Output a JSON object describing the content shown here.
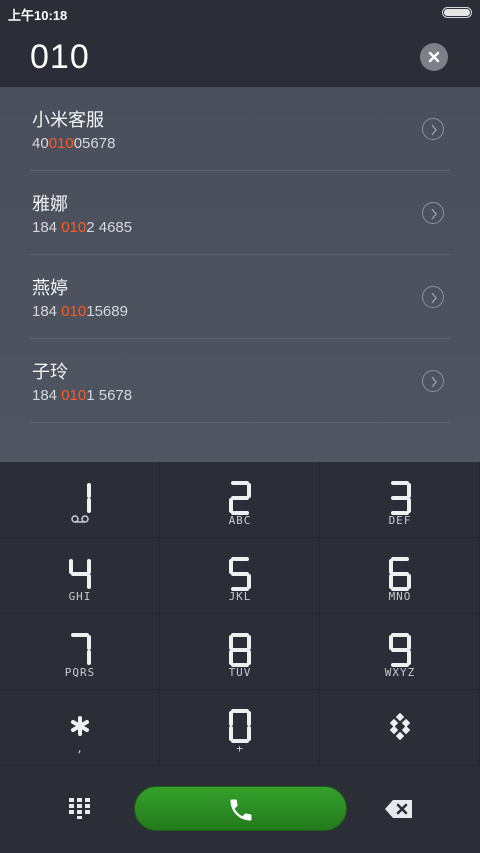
{
  "status_bar": {
    "time": "上午10:18"
  },
  "dial_input": {
    "number": "010"
  },
  "contacts": [
    {
      "name": "小米客服",
      "number_pre": "40",
      "number_match": "010",
      "number_post": "05678"
    },
    {
      "name": "雅娜",
      "number_pre": "184 ",
      "number_match": "010",
      "number_post": "2 4685"
    },
    {
      "name": "燕婷",
      "number_pre": "184 ",
      "number_match": "010",
      "number_post": "15689"
    },
    {
      "name": "子玲",
      "number_pre": "184 ",
      "number_match": "010",
      "number_post": "1 5678"
    }
  ],
  "keypad": {
    "keys": [
      {
        "digit": "1",
        "letters": ""
      },
      {
        "digit": "2",
        "letters": "ABC"
      },
      {
        "digit": "3",
        "letters": "DEF"
      },
      {
        "digit": "4",
        "letters": "GHI"
      },
      {
        "digit": "5",
        "letters": "JKL"
      },
      {
        "digit": "6",
        "letters": "MNO"
      },
      {
        "digit": "7",
        "letters": "PQRS"
      },
      {
        "digit": "8",
        "letters": "TUV"
      },
      {
        "digit": "9",
        "letters": "WXYZ"
      },
      {
        "digit": "*",
        "letters": ","
      },
      {
        "digit": "0",
        "letters": "+"
      },
      {
        "digit": "#",
        "letters": ""
      }
    ]
  },
  "colors": {
    "match_highlight": "#ff5a1f",
    "call_button": "#2e8f25",
    "background": "#2b2e36"
  },
  "icons": {
    "clear": "clear-icon",
    "chevron": "chevron-right-icon",
    "voicemail": "voicemail-icon",
    "call": "phone-icon",
    "dialpad": "dialpad-grid-icon",
    "backspace": "backspace-icon"
  }
}
